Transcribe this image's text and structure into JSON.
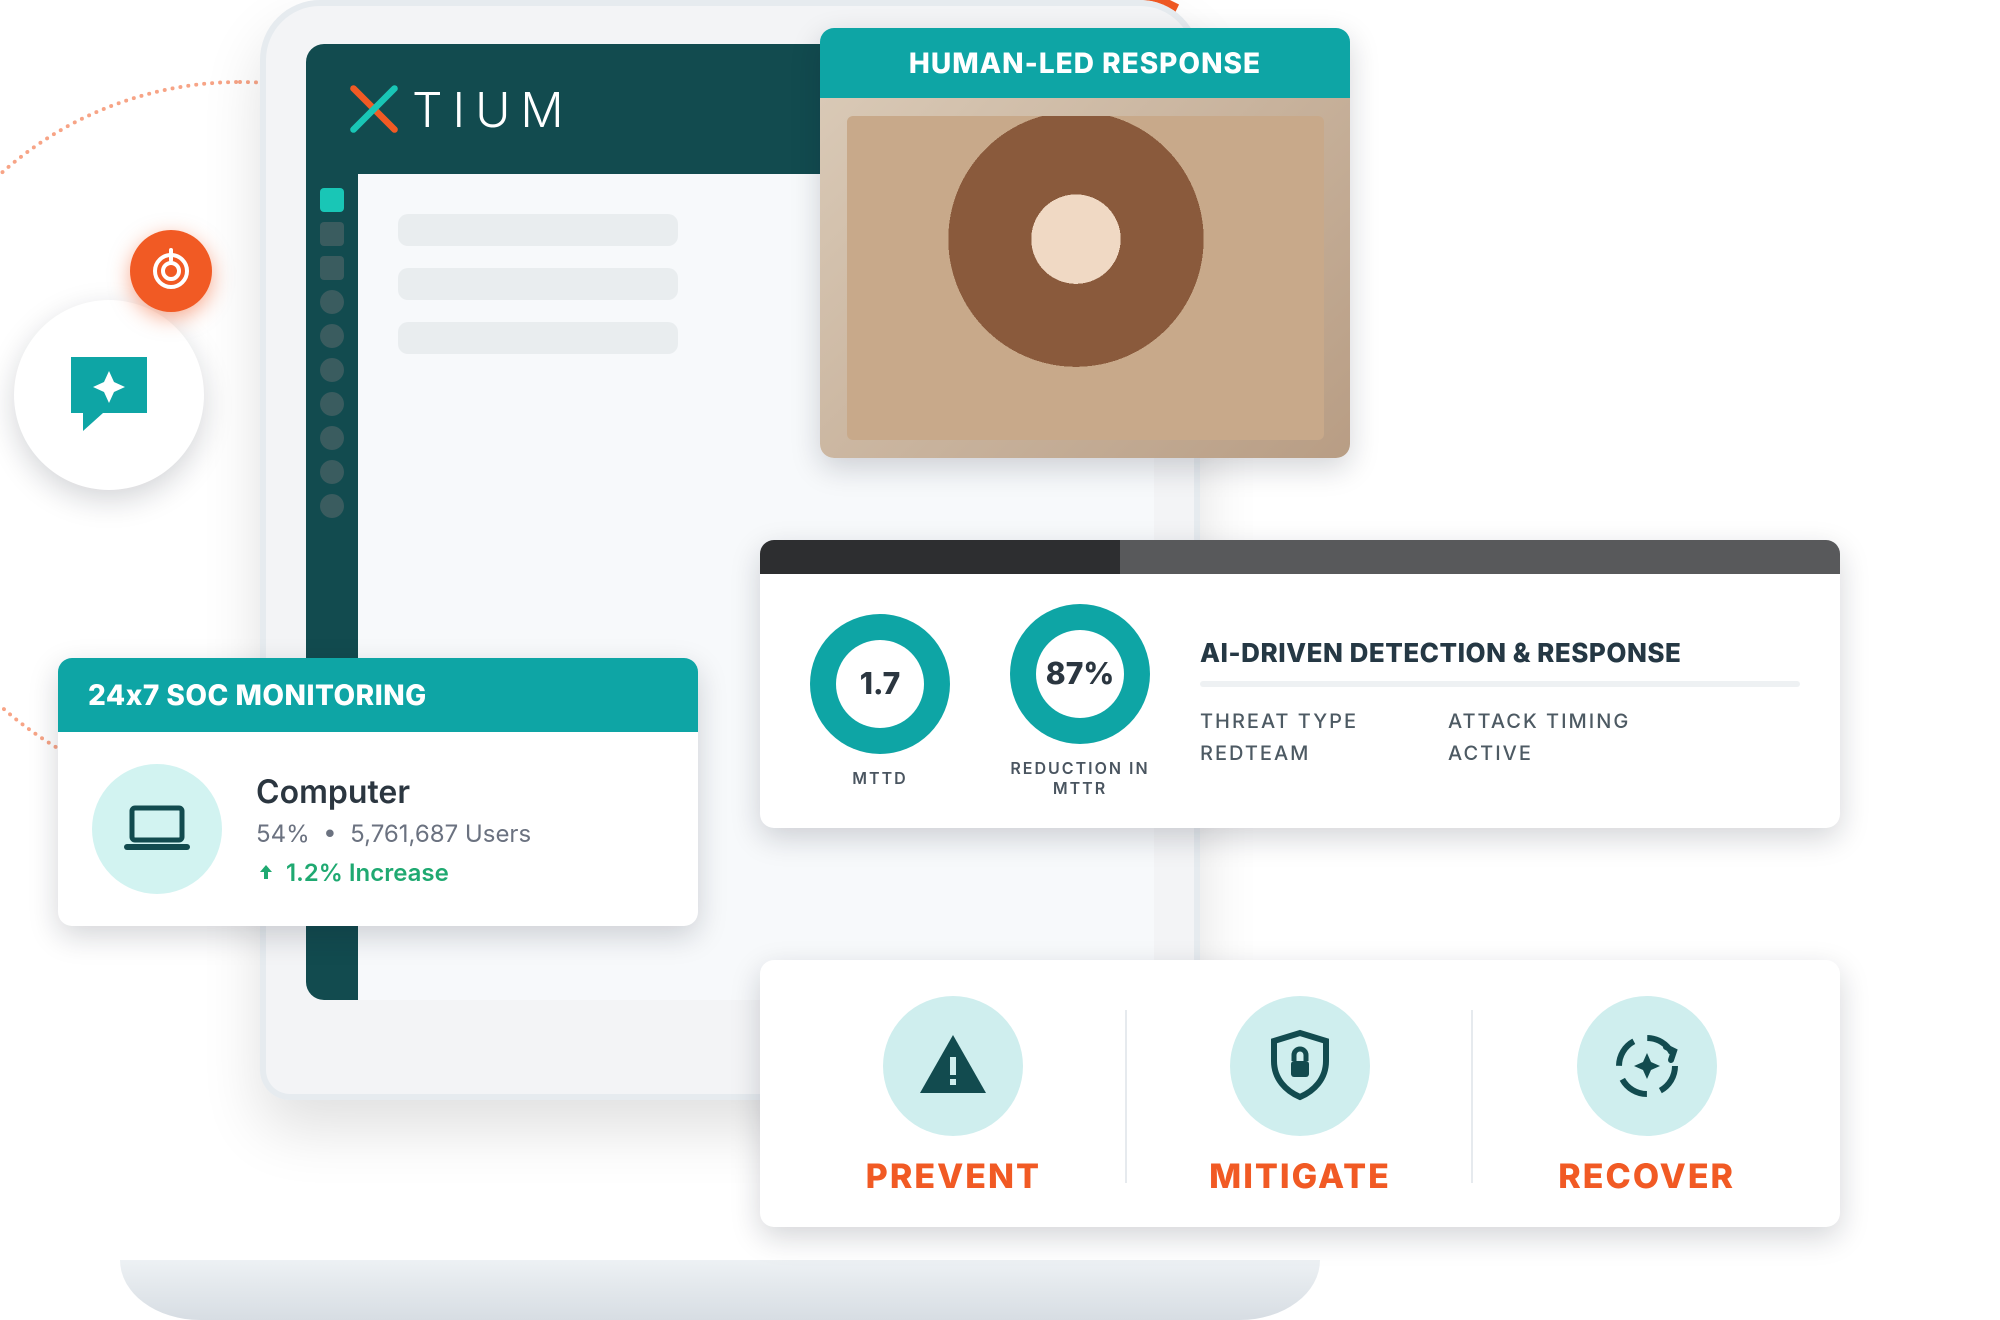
{
  "brand": {
    "name": "TIUM",
    "full": "XTIUM"
  },
  "soc": {
    "header": "24x7 SOC MONITORING",
    "device_title": "Computer",
    "percent": "54%",
    "users": "5,761,687 Users",
    "delta": "1.2% Increase"
  },
  "human_led": {
    "title": "HUMAN-LED RESPONSE"
  },
  "ai": {
    "mttd_value": "1.7",
    "mttd_label": "MTTD",
    "mttr_value": "87%",
    "mttr_label": "REDUCTION IN MTTR",
    "title": "AI-DRIVEN DETECTION & RESPONSE",
    "col1a": "THREAT TYPE",
    "col1b": "REDTEAM",
    "col2a": "ATTACK TIMING",
    "col2b": "ACTIVE"
  },
  "features": {
    "prevent": "PREVENT",
    "mitigate": "MITIGATE",
    "recover": "RECOVER"
  },
  "chart_data": {
    "type": "table",
    "title": "AI-Driven Detection & Response KPIs",
    "rows": [
      {
        "metric": "MTTD",
        "value": 1.7,
        "unit": ""
      },
      {
        "metric": "Reduction in MTTR",
        "value": 87,
        "unit": "%"
      }
    ]
  }
}
